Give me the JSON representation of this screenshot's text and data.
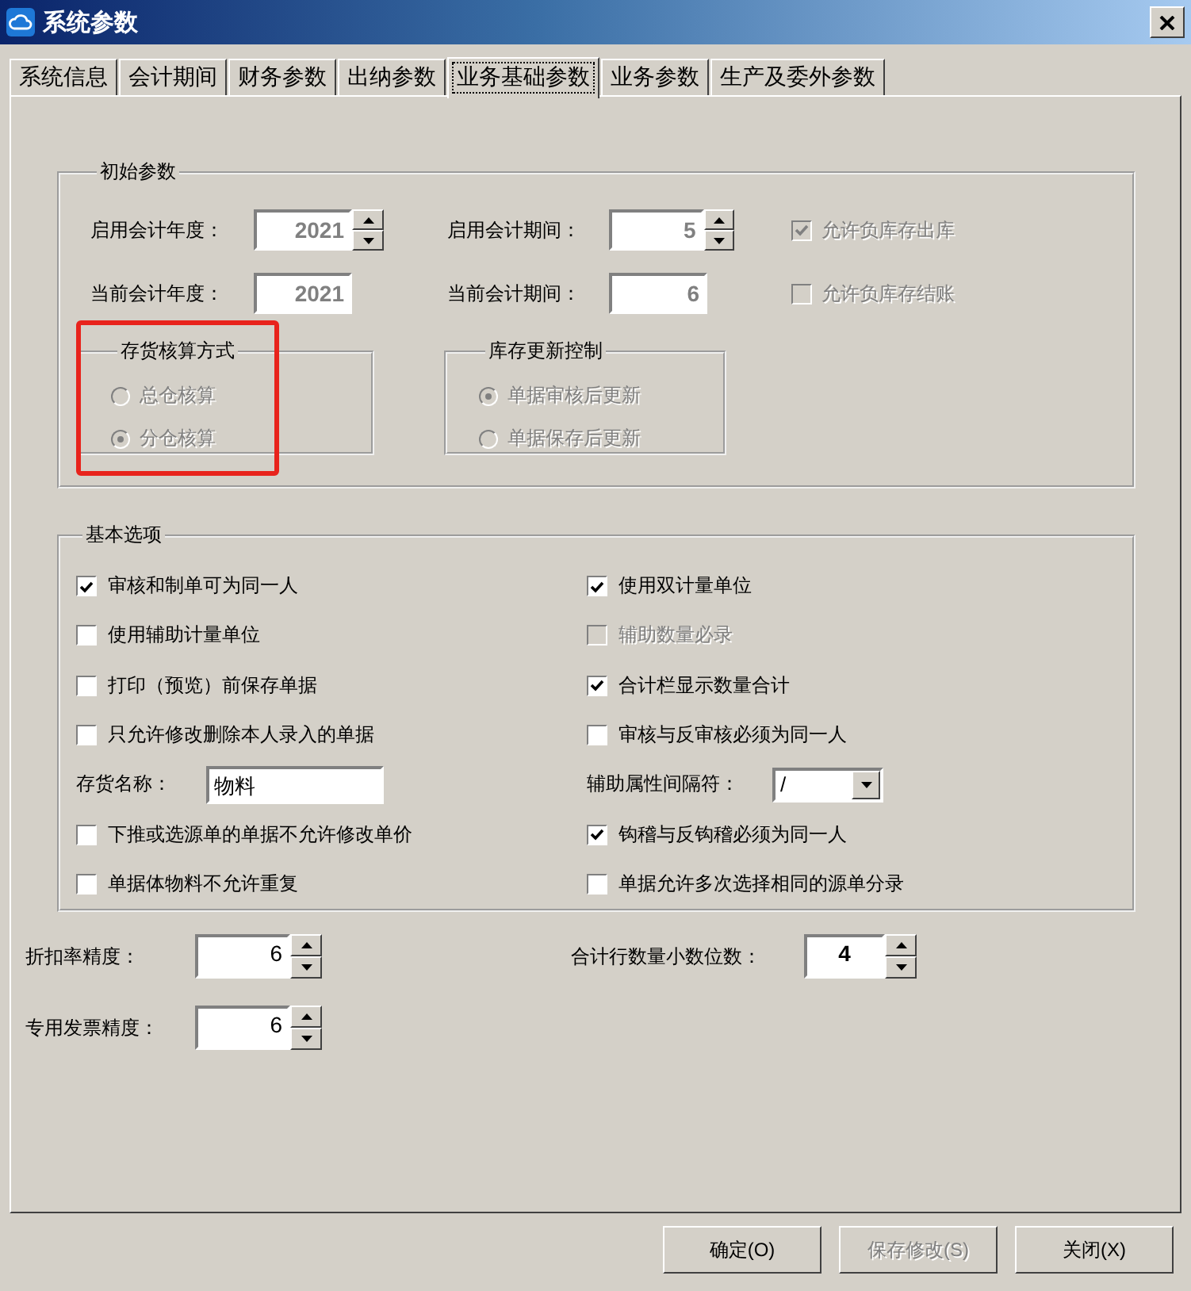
{
  "window": {
    "title": "系统参数"
  },
  "tabs": [
    {
      "label": "系统信息",
      "selected": false
    },
    {
      "label": "会计期间",
      "selected": false
    },
    {
      "label": "财务参数",
      "selected": false
    },
    {
      "label": "出纳参数",
      "selected": false
    },
    {
      "label": "业务基础参数",
      "selected": true
    },
    {
      "label": "业务参数",
      "selected": false
    },
    {
      "label": "生产及委外参数",
      "selected": false
    }
  ],
  "initial_params": {
    "title": "初始参数",
    "fields": [
      {
        "label": "启用会计年度：",
        "value": "2021",
        "spinner": true,
        "disabled": true
      },
      {
        "label": "启用会计期间：",
        "value": "5",
        "spinner": true,
        "disabled": true
      },
      {
        "label": "当前会计年度：",
        "value": "2021",
        "spinner": false,
        "disabled": true
      },
      {
        "label": "当前会计期间：",
        "value": "6",
        "spinner": false,
        "disabled": true
      }
    ],
    "checks": [
      {
        "label": "允许负库存出库",
        "checked": true,
        "disabled": true
      },
      {
        "label": "允许负库存结账",
        "checked": false,
        "disabled": true
      }
    ],
    "radio_groups": [
      {
        "title": "存货核算方式",
        "highlighted": true,
        "disabled": true,
        "options": [
          {
            "label": "总仓核算",
            "selected": false
          },
          {
            "label": "分仓核算",
            "selected": true
          }
        ]
      },
      {
        "title": "库存更新控制",
        "highlighted": false,
        "disabled": true,
        "options": [
          {
            "label": "单据审核后更新",
            "selected": true
          },
          {
            "label": "单据保存后更新",
            "selected": false
          }
        ]
      }
    ]
  },
  "basic_options": {
    "title": "基本选项",
    "left": [
      {
        "kind": "checkbox",
        "label": "审核和制单可为同一人",
        "checked": true,
        "disabled": false
      },
      {
        "kind": "checkbox",
        "label": "使用辅助计量单位",
        "checked": false,
        "disabled": false
      },
      {
        "kind": "checkbox",
        "label": "打印（预览）前保存单据",
        "checked": false,
        "disabled": false
      },
      {
        "kind": "checkbox",
        "label": "只允许修改删除本人录入的单据",
        "checked": false,
        "disabled": false
      },
      {
        "kind": "text",
        "label": "存货名称：",
        "value": "物料"
      },
      {
        "kind": "checkbox",
        "label": "下推或选源单的单据不允许修改单价",
        "checked": false,
        "disabled": false
      },
      {
        "kind": "checkbox",
        "label": "单据体物料不允许重复",
        "checked": false,
        "disabled": false
      }
    ],
    "right": [
      {
        "kind": "checkbox",
        "label": "使用双计量单位",
        "checked": true,
        "disabled": false
      },
      {
        "kind": "checkbox",
        "label": "辅助数量必录",
        "checked": false,
        "disabled": true
      },
      {
        "kind": "checkbox",
        "label": "合计栏显示数量合计",
        "checked": true,
        "disabled": false
      },
      {
        "kind": "checkbox",
        "label": "审核与反审核必须为同一人",
        "checked": false,
        "disabled": false
      },
      {
        "kind": "dropdown",
        "label": "辅助属性间隔符：",
        "value": "/"
      },
      {
        "kind": "checkbox",
        "label": "钩稽与反钩稽必须为同一人",
        "checked": true,
        "disabled": false
      },
      {
        "kind": "checkbox",
        "label": "单据允许多次选择相同的源单分录",
        "checked": false,
        "disabled": false
      }
    ]
  },
  "precision": [
    {
      "label": "折扣率精度：",
      "value": "6",
      "bold": false
    },
    {
      "label": "合计行数量小数位数：",
      "value": "4",
      "bold": true
    },
    {
      "label": "专用发票精度：",
      "value": "6",
      "bold": false
    }
  ],
  "buttons": [
    {
      "label": "确定(O)",
      "disabled": false
    },
    {
      "label": "保存修改(S)",
      "disabled": true
    },
    {
      "label": "关闭(X)",
      "disabled": false
    }
  ]
}
